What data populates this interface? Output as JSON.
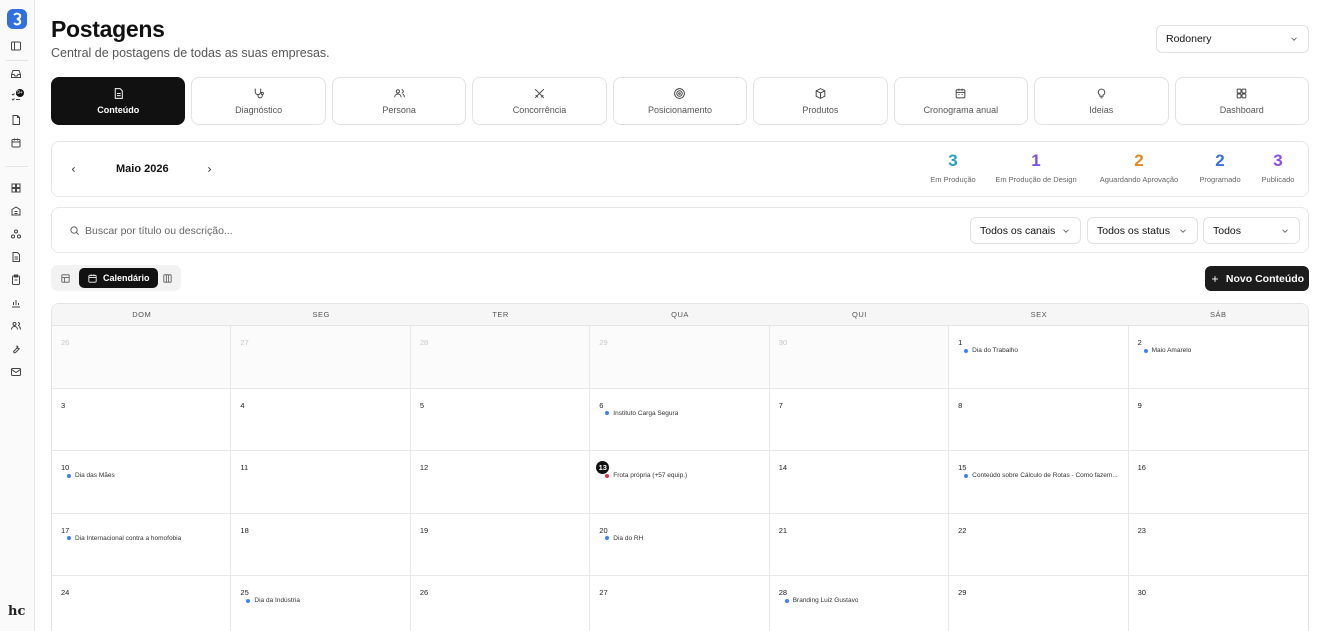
{
  "header": {
    "title": "Postagens",
    "subtitle": "Central de postagens de todas as suas empresas.",
    "company_select": "Rodonery"
  },
  "sidebar": {
    "logo_icon": "app-logo",
    "badge": "9+",
    "bottom_mark": "hc"
  },
  "tabs": [
    {
      "label": "Conteúdo",
      "icon": "document-icon",
      "active": true
    },
    {
      "label": "Diagnóstico",
      "icon": "stethoscope-icon",
      "active": false
    },
    {
      "label": "Persona",
      "icon": "users-icon",
      "active": false
    },
    {
      "label": "Concorrência",
      "icon": "swords-icon",
      "active": false
    },
    {
      "label": "Posicionamento",
      "icon": "target-icon",
      "active": false
    },
    {
      "label": "Produtos",
      "icon": "box-icon",
      "active": false
    },
    {
      "label": "Cronograma anual",
      "icon": "calendar-icon",
      "active": false
    },
    {
      "label": "Ideias",
      "icon": "lightbulb-icon",
      "active": false
    },
    {
      "label": "Dashboard",
      "icon": "dashboard-icon",
      "active": false
    }
  ],
  "month_bar": {
    "month": "Maio 2026",
    "stats": [
      {
        "value": "3",
        "label": "Em Produção",
        "color": "#2a9ec4"
      },
      {
        "value": "1",
        "label": "Em Produção de Design",
        "color": "#7b4fe0"
      },
      {
        "value": "2",
        "label": "Aguardando Aprovação",
        "color": "#e38a1f"
      },
      {
        "value": "2",
        "label": "Programado",
        "color": "#3a6fe0"
      },
      {
        "value": "3",
        "label": "Publicado",
        "color": "#8a4fe0"
      }
    ]
  },
  "filters": {
    "search_placeholder": "Buscar por título ou descrição...",
    "channels": "Todos os canais",
    "status": "Todos os status",
    "other": "Todos"
  },
  "view": {
    "calendar_label": "Calendário",
    "new_button": "Novo Conteúdo"
  },
  "calendar": {
    "weekdays": [
      "DOM",
      "SEG",
      "TER",
      "QUA",
      "QUI",
      "SEX",
      "SÁB"
    ],
    "cells": [
      {
        "day": "26",
        "muted": true,
        "event": null
      },
      {
        "day": "27",
        "muted": true,
        "event": null
      },
      {
        "day": "28",
        "muted": true,
        "event": null
      },
      {
        "day": "29",
        "muted": true,
        "event": null
      },
      {
        "day": "30",
        "muted": true,
        "event": null
      },
      {
        "day": "1",
        "muted": false,
        "event": {
          "title": "Dia do Trabalho",
          "color": "#3b82f6"
        }
      },
      {
        "day": "2",
        "muted": false,
        "event": {
          "title": "Maio Amarelo",
          "color": "#3b82f6"
        }
      },
      {
        "day": "3",
        "muted": false,
        "event": null
      },
      {
        "day": "4",
        "muted": false,
        "event": null
      },
      {
        "day": "5",
        "muted": false,
        "event": null
      },
      {
        "day": "6",
        "muted": false,
        "event": {
          "title": "Instituto Carga Segura",
          "color": "#3b82f6"
        }
      },
      {
        "day": "7",
        "muted": false,
        "event": null
      },
      {
        "day": "8",
        "muted": false,
        "event": null
      },
      {
        "day": "9",
        "muted": false,
        "event": null
      },
      {
        "day": "10",
        "muted": false,
        "event": {
          "title": "Dia das Mães",
          "color": "#3b82f6"
        }
      },
      {
        "day": "11",
        "muted": false,
        "event": null
      },
      {
        "day": "12",
        "muted": false,
        "event": null
      },
      {
        "day": "13",
        "muted": false,
        "today": true,
        "event": {
          "title": "Frota própria (+57 equip.)",
          "color": "#e0314b"
        }
      },
      {
        "day": "14",
        "muted": false,
        "event": null
      },
      {
        "day": "15",
        "muted": false,
        "event": {
          "title": "Conteúdo sobre Cálculo de Rotas - Como fazem...",
          "color": "#3b82f6"
        }
      },
      {
        "day": "16",
        "muted": false,
        "event": null
      },
      {
        "day": "17",
        "muted": false,
        "event": {
          "title": "Dia Internacional contra a homofobia",
          "color": "#3b82f6"
        }
      },
      {
        "day": "18",
        "muted": false,
        "event": null
      },
      {
        "day": "19",
        "muted": false,
        "event": null
      },
      {
        "day": "20",
        "muted": false,
        "event": {
          "title": "Dia do RH",
          "color": "#3b82f6"
        }
      },
      {
        "day": "21",
        "muted": false,
        "event": null
      },
      {
        "day": "22",
        "muted": false,
        "event": null
      },
      {
        "day": "23",
        "muted": false,
        "event": null
      },
      {
        "day": "24",
        "muted": false,
        "event": null
      },
      {
        "day": "25",
        "muted": false,
        "event": {
          "title": "Dia da Indústria",
          "color": "#3b82f6"
        }
      },
      {
        "day": "26",
        "muted": false,
        "event": null
      },
      {
        "day": "27",
        "muted": false,
        "event": null
      },
      {
        "day": "28",
        "muted": false,
        "event": {
          "title": "Branding Luiz Gustavo",
          "color": "#3b82f6"
        }
      },
      {
        "day": "29",
        "muted": false,
        "event": null
      },
      {
        "day": "30",
        "muted": false,
        "event": null
      }
    ]
  }
}
